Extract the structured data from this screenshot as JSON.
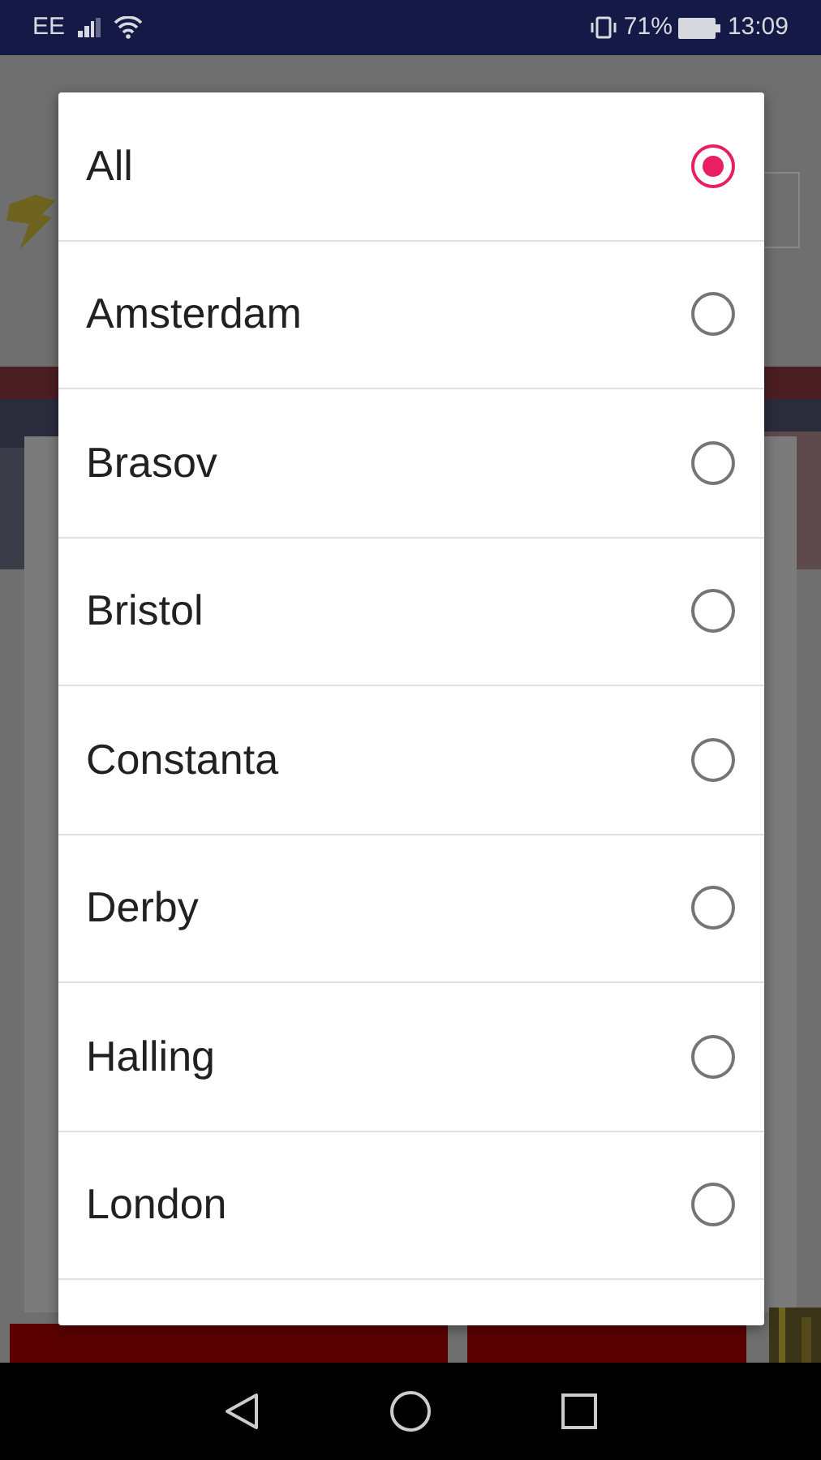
{
  "status_bar": {
    "carrier": "EE",
    "battery": "71%",
    "time": "13:09"
  },
  "dialog": {
    "options": [
      {
        "label": "All",
        "selected": true
      },
      {
        "label": "Amsterdam",
        "selected": false
      },
      {
        "label": "Brasov",
        "selected": false
      },
      {
        "label": "Bristol",
        "selected": false
      },
      {
        "label": "Constanta",
        "selected": false
      },
      {
        "label": "Derby",
        "selected": false
      },
      {
        "label": "Halling",
        "selected": false
      },
      {
        "label": "London",
        "selected": false
      }
    ]
  }
}
